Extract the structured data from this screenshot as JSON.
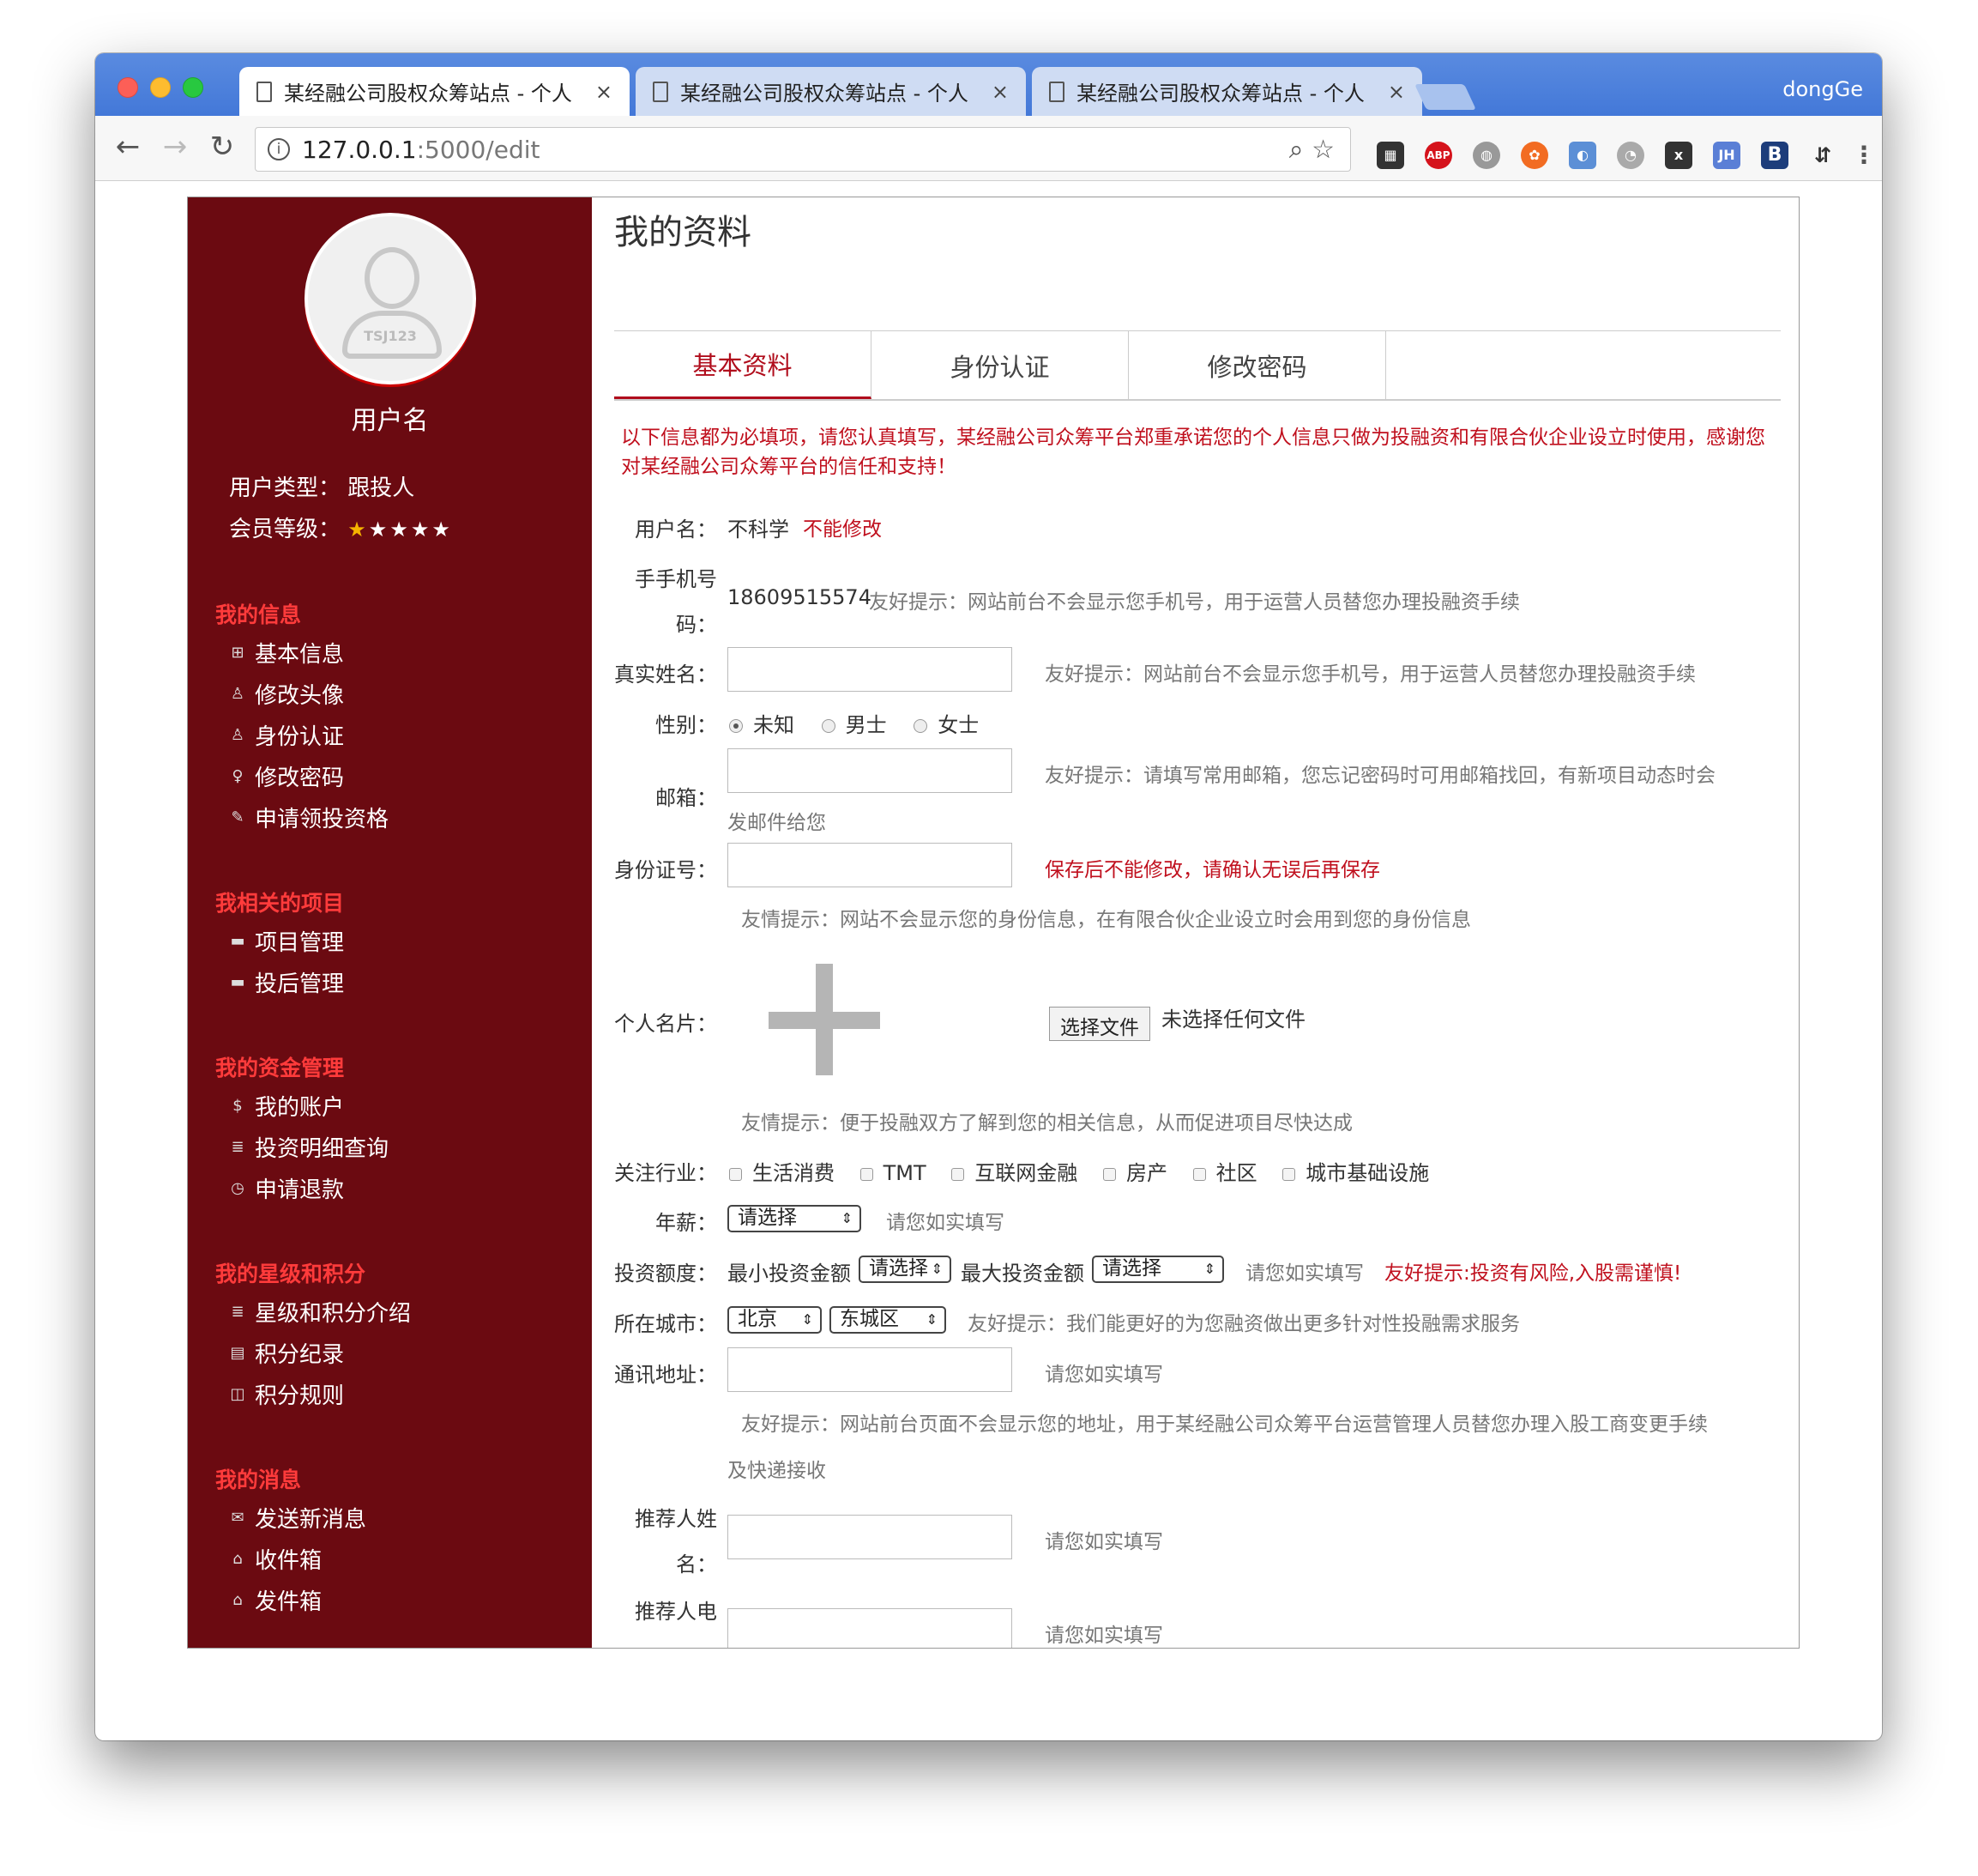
{
  "browser": {
    "tabs": [
      {
        "title": "某经融公司股权众筹站点 - 个人"
      },
      {
        "title": "某经融公司股权众筹站点 - 个人"
      },
      {
        "title": "某经融公司股权众筹站点 - 个人"
      }
    ],
    "profile_name": "dongGe",
    "url_host": "127.0.0.1",
    "url_path": ":5000/edit"
  },
  "sidebar": {
    "avatar_tag": "TSJ123",
    "username": "用户名",
    "user_type_label": "用户类型：",
    "user_type_value": "跟投人",
    "member_level_label": "会员等级：",
    "member_level_stars": 1,
    "sections": [
      {
        "title": "我的信息",
        "items": [
          "基本信息",
          "修改头像",
          "身份认证",
          "修改密码",
          "申请领投资格"
        ]
      },
      {
        "title": "我相关的项目",
        "items": [
          "项目管理",
          "投后管理"
        ]
      },
      {
        "title": "我的资金管理",
        "items": [
          "我的账户",
          "投资明细查询",
          "申请退款"
        ]
      },
      {
        "title": "我的星级和积分",
        "items": [
          "星级和积分介绍",
          "积分纪录",
          "积分规则"
        ]
      },
      {
        "title": "我的消息",
        "items": [
          "发送新消息",
          "收件箱",
          "发件箱"
        ]
      }
    ]
  },
  "main": {
    "title": "我的资料",
    "tabs": [
      "基本资料",
      "身份认证",
      "修改密码"
    ],
    "notice": "以下信息都为必填项，请您认真填写，某经融公司众筹平台郑重承诺您的个人信息只做为投融资和有限合伙企业设立时使用，感谢您对某经融公司众筹平台的信任和支持！",
    "username_label": "用户名：",
    "username_value": "不科学",
    "username_note": "不能修改",
    "phone_label_1": "手手机号",
    "phone_label_2": "码：",
    "phone_value": "18609515574",
    "phone_hint": "友好提示：网站前台不会显示您手机号，用于运营人员替您办理投融资手续",
    "realname_label": "真实姓名：",
    "realname_hint": "友好提示：网站前台不会显示您手机号，用于运营人员替您办理投融资手续",
    "gender_label": "性别：",
    "gender_options": [
      "未知",
      "男士",
      "女士"
    ],
    "email_label": "邮箱：",
    "email_hint_1": "友好提示：请填写常用邮箱，您忘记密码时可用邮箱找回，有新项目动态时会",
    "email_hint_2": "发邮件给您",
    "idcard_label": "身份证号：",
    "idcard_warn": "保存后不能修改，请确认无误后再保存",
    "idcard_hint": "友情提示：网站不会显示您的身份信息，在有限合伙企业设立时会用到您的身份信息",
    "card_label": "个人名片：",
    "file_button": "选择文件",
    "file_status": "未选择任何文件",
    "card_hint": "友情提示：便于投融双方了解到您的相关信息，从而促进项目尽快达成",
    "industry_label": "关注行业：",
    "industries": [
      "生活消费",
      "TMT",
      "互联网金融",
      "房产",
      "社区",
      "城市基础设施"
    ],
    "salary_label": "年薪：",
    "salary_select": "请选择",
    "salary_hint": "请您如实填写",
    "invest_label": "投资额度：",
    "min_invest_label": "最小投资金额",
    "min_invest_select": "请选择",
    "max_invest_label": "最大投资金额",
    "max_invest_select": "请选择",
    "invest_hint": "请您如实填写",
    "invest_warn": "友好提示:投资有风险,入股需谨慎!",
    "city_label": "所在城市：",
    "city_select": "北京",
    "district_select": "东城区",
    "city_hint": "友好提示：我们能更好的为您融资做出更多针对性投融需求服务",
    "address_label": "通讯地址：",
    "address_hint": "请您如实填写",
    "address_tip_1": "友好提示：网站前台页面不会显示您的地址，用于某经融公司众筹平台运营管理人员替您办理入股工商变更手续",
    "address_tip_2": "及快递接收",
    "referrer_name_label_1": "推荐人姓",
    "referrer_name_label_2": "名：",
    "referrer_name_hint": "请您如实填写",
    "referrer_phone_label": "推荐人电",
    "referrer_phone_hint": "请您如实填写"
  }
}
